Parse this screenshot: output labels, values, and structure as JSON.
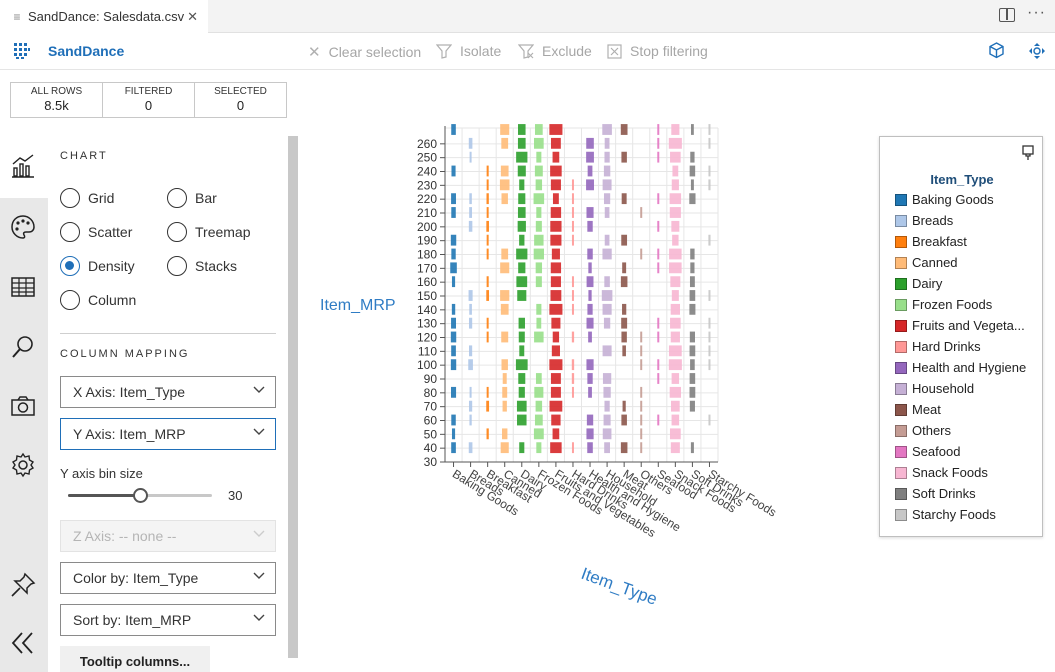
{
  "tab": {
    "title": "SandDance: Salesdata.csv",
    "close": "✕",
    "file_icon": "≡"
  },
  "toolbar": {
    "app_name": "SandDance",
    "clear_selection": "Clear selection",
    "isolate": "Isolate",
    "exclude": "Exclude",
    "stop_filtering": "Stop filtering"
  },
  "counts": {
    "all_rows_label": "ALL ROWS",
    "all_rows_value": "8.5k",
    "filtered_label": "FILTERED",
    "filtered_value": "0",
    "selected_label": "SELECTED",
    "selected_value": "0"
  },
  "panel": {
    "chart_title": "CHART",
    "chart_types": [
      {
        "label": "Grid",
        "checked": false
      },
      {
        "label": "Bar",
        "checked": false
      },
      {
        "label": "Scatter",
        "checked": false
      },
      {
        "label": "Treemap",
        "checked": false
      },
      {
        "label": "Density",
        "checked": true
      },
      {
        "label": "Stacks",
        "checked": false
      },
      {
        "label": "Column",
        "checked": false
      }
    ],
    "mapping_title": "COLUMN MAPPING",
    "x_axis": "X Axis: Item_Type",
    "y_axis": "Y Axis: Item_MRP",
    "y_bin_label": "Y axis bin size",
    "y_bin_value": "30",
    "y_bin_fraction": 0.5,
    "z_axis": "Z Axis: -- none --",
    "color_by": "Color by: Item_Type",
    "sort_by": "Sort by: Item_MRP",
    "tooltip_button": "Tooltip columns..."
  },
  "chart_data": {
    "type": "heatmap",
    "xlabel": "Item_Type",
    "ylabel": "Item_MRP",
    "categories": [
      "Baking Goods",
      "Breads",
      "Breakfast",
      "Canned",
      "Dairy",
      "Frozen Foods",
      "Fruits and Vegetables",
      "Hard Drinks",
      "Health and Hygiene",
      "Household",
      "Meat",
      "Others",
      "Seafood",
      "Snack Foods",
      "Soft Drinks",
      "Starchy Foods"
    ],
    "colors": [
      "#1f77b4",
      "#aec7e8",
      "#ff7f0e",
      "#ffbb78",
      "#2ca02c",
      "#98df8a",
      "#d62728",
      "#ff9896",
      "#9467bd",
      "#c5b0d5",
      "#8c564b",
      "#c49c94",
      "#e377c2",
      "#f7b6d2",
      "#7f7f7f",
      "#c7c7c7"
    ],
    "yticks": [
      30,
      40,
      50,
      60,
      70,
      80,
      90,
      100,
      110,
      120,
      130,
      140,
      150,
      160,
      170,
      180,
      190,
      200,
      210,
      220,
      230,
      240,
      250,
      260
    ],
    "ylim": [
      30,
      270
    ],
    "relative_density": [
      0.45,
      0.32,
      0.2,
      0.65,
      0.8,
      0.72,
      1.0,
      0.2,
      0.55,
      0.78,
      0.45,
      0.15,
      0.08,
      0.95,
      0.42,
      0.15
    ],
    "legend_title": "Item_Type",
    "legend_items": [
      "Baking Goods",
      "Breads",
      "Breakfast",
      "Canned",
      "Dairy",
      "Frozen Foods",
      "Fruits and Vegeta...",
      "Hard Drinks",
      "Health and Hygiene",
      "Household",
      "Meat",
      "Others",
      "Seafood",
      "Snack Foods",
      "Soft Drinks",
      "Starchy Foods"
    ],
    "grid": true,
    "legend_position": "right"
  },
  "icons": {
    "rail": [
      "chart-icon",
      "palette-icon",
      "table-icon",
      "search-icon",
      "camera-icon",
      "settings-icon",
      "pin-icon",
      "collapse-icon"
    ]
  }
}
